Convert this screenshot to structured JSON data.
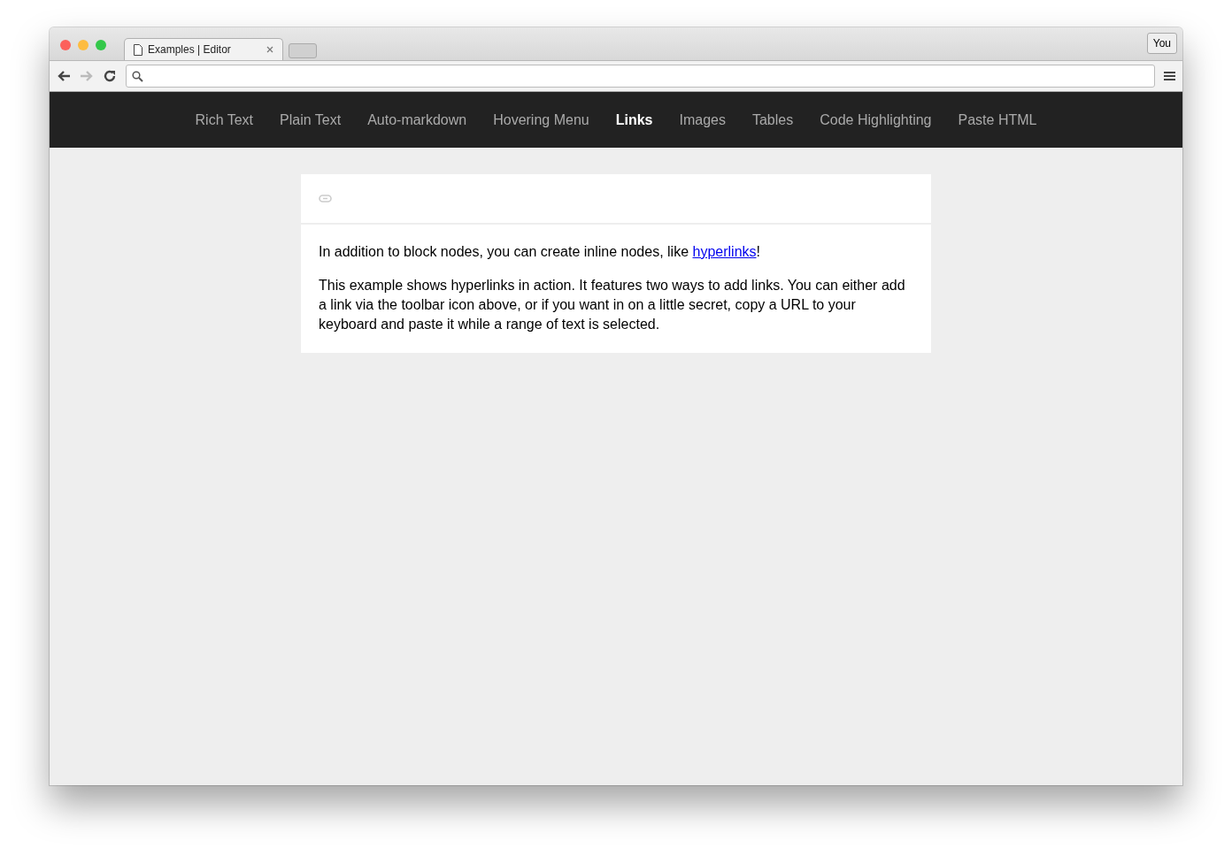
{
  "browser": {
    "tab_title": "Examples | Editor",
    "profile_button": "You"
  },
  "nav": [
    {
      "label": "Rich Text",
      "selected": false
    },
    {
      "label": "Plain Text",
      "selected": false
    },
    {
      "label": "Auto-markdown",
      "selected": false
    },
    {
      "label": "Hovering Menu",
      "selected": false
    },
    {
      "label": "Links",
      "selected": true
    },
    {
      "label": "Images",
      "selected": false
    },
    {
      "label": "Tables",
      "selected": false
    },
    {
      "label": "Code Highlighting",
      "selected": false
    },
    {
      "label": "Paste HTML",
      "selected": false
    }
  ],
  "editor": {
    "paragraphs": [
      {
        "text": "In addition to block nodes, you can create inline nodes, like ",
        "link": "hyperlinks",
        "after": "!"
      },
      {
        "text": "This example shows hyperlinks in action. It features two ways to add links. You can either add a link via the toolbar icon above, or if you want in on a little secret, copy a URL to your keyboard and paste it while a range of text is selected."
      }
    ]
  }
}
